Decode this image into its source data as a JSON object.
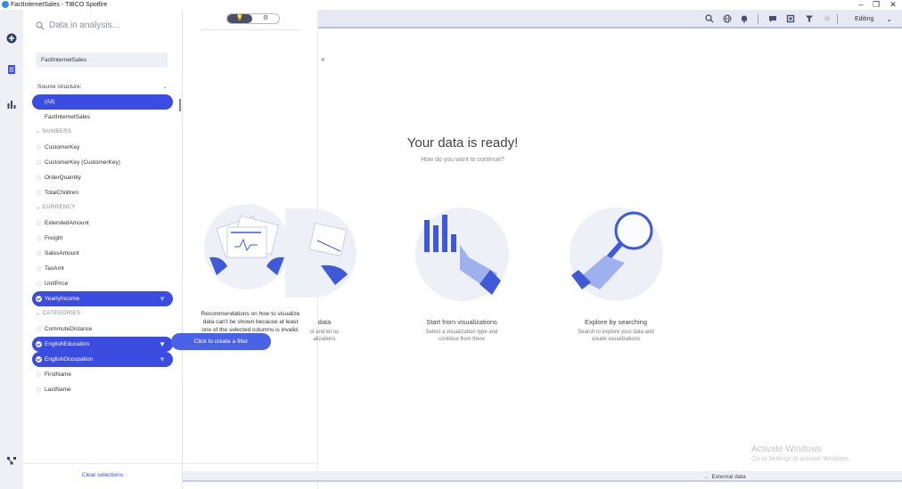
{
  "window": {
    "title": "FactInternetSales - TIBCO Spotfire",
    "minimize": "–",
    "maximize": "❐",
    "close": "✕"
  },
  "toolbar": {
    "mode": "Editing",
    "mode_caret": "⌄",
    "icons": [
      "search-icon",
      "globe-icon",
      "bell-icon",
      "chat-icon",
      "bookmark-icon",
      "filter-icon",
      "gear-icon"
    ]
  },
  "iconbar": {
    "icons": [
      "add-icon",
      "data-icon",
      "visualization-icon",
      "data-canvas-icon"
    ]
  },
  "data_panel": {
    "search_placeholder": "Data in analysis...",
    "search_icon": "search-icon",
    "data_table": "FactInternetSales",
    "source_structure_label": "Source structure:",
    "source_caret": "⌄",
    "sources": [
      {
        "label": "(All)",
        "selected": true
      },
      {
        "label": "FactInternetSales",
        "selected": false
      }
    ],
    "categories": [
      {
        "name": "NUMBERS",
        "items": [
          {
            "label": "CustomerKey",
            "selected": false
          },
          {
            "label": "CustomerKey (CustomerKey)",
            "selected": false
          },
          {
            "label": "OrderQuantity",
            "selected": false
          },
          {
            "label": "TotalChildren",
            "selected": false
          }
        ]
      },
      {
        "name": "CURRENCY",
        "items": [
          {
            "label": "ExtendedAmount",
            "selected": false
          },
          {
            "label": "Freight",
            "selected": false
          },
          {
            "label": "SalesAmount",
            "selected": false
          },
          {
            "label": "TaxAmt",
            "selected": false
          },
          {
            "label": "UnitPrice",
            "selected": false
          },
          {
            "label": "YearlyIncome",
            "selected": true,
            "filter": true
          }
        ]
      },
      {
        "name": "CATEGORIES",
        "items": [
          {
            "label": "CommuteDistance",
            "selected": false
          },
          {
            "label": "EnglishEducation",
            "selected": true,
            "filter": true
          },
          {
            "label": "EnglishOccupation",
            "selected": true,
            "filter": true
          },
          {
            "label": "FirstName",
            "selected": false
          },
          {
            "label": "LastName",
            "selected": false
          }
        ]
      }
    ],
    "clear_label": "Clear selections",
    "tooltip": "Click to create a filter"
  },
  "recommendations": {
    "tab_icons": [
      "lightbulb-icon",
      "gear-icon"
    ],
    "message_lines": [
      "Recommendations on how to visualize",
      "data can't be shown because at least",
      "one of the selected columns is invalid."
    ]
  },
  "main": {
    "collapse_glyph": "«",
    "title": "Your data is ready!",
    "subtitle": "How do you want to continue?",
    "options": [
      {
        "title": "data",
        "desc_lines": [
          "st and let us",
          "alizations"
        ]
      },
      {
        "title": "Start from visualizations",
        "desc_lines": [
          "Select a visualization type and",
          "continue from there"
        ]
      },
      {
        "title": "Explore by searching",
        "desc_lines": [
          "Search to explore your data and",
          "create visualizations"
        ]
      }
    ]
  },
  "statusbar": {
    "external_data": "External data",
    "caret": "⌄"
  },
  "watermark": {
    "line1": "Activate Windows",
    "line2": "Go to Settings to activate Windows."
  },
  "colors": {
    "accent": "#3b4ce0",
    "toolbar_bg": "#e6e9f3",
    "illustration_blue": "#3e5ad8"
  }
}
